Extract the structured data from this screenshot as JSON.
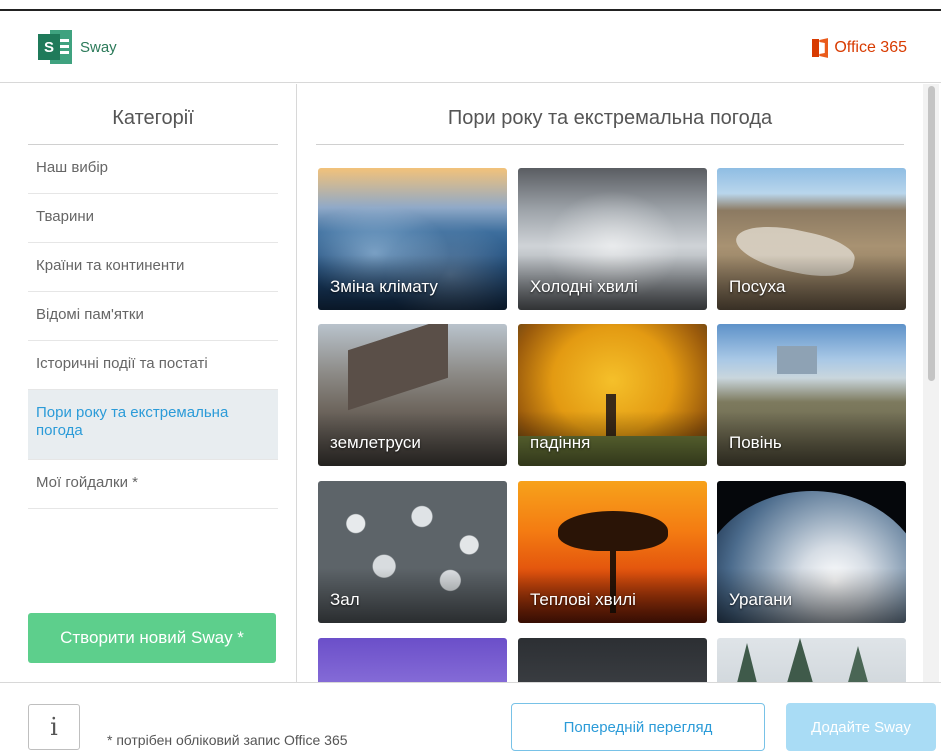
{
  "header": {
    "app_name": "Sway",
    "app_badge": "S",
    "brand": "Office 365"
  },
  "sidebar": {
    "title": "Категорії",
    "items": [
      {
        "label": "Наш вибір"
      },
      {
        "label": "Тварини"
      },
      {
        "label": "Країни та континенти"
      },
      {
        "label": "Відомі пам'ятки"
      },
      {
        "label": "Історичні події та постаті"
      },
      {
        "label": "Пори року та екстремальна погода",
        "active": true
      },
      {
        "label": "Мої гойдалки *"
      }
    ],
    "create_button": "Створити новий Sway *"
  },
  "main": {
    "title": "Пори року та екстремальна погода",
    "tiles": [
      {
        "label": "Зміна клімату",
        "image": "climate-change-image"
      },
      {
        "label": "Холодні хвилі",
        "image": "cold-waves-image"
      },
      {
        "label": "Посуха",
        "image": "drought-image"
      },
      {
        "label": "землетруси",
        "image": "earthquakes-image"
      },
      {
        "label": "падіння",
        "image": "autumn-image"
      },
      {
        "label": "Повінь",
        "image": "flood-image"
      },
      {
        "label": "Зал",
        "image": "hail-image"
      },
      {
        "label": "Теплові хвилі",
        "image": "heat-waves-image"
      },
      {
        "label": "Урагани",
        "image": "hurricanes-image"
      },
      {
        "label": "",
        "image": "lightning-image"
      },
      {
        "label": "",
        "image": "rain-image"
      },
      {
        "label": "",
        "image": "snow-image"
      }
    ]
  },
  "footer": {
    "info_glyph": "i",
    "footnote": "* потрібен обліковий запис Office 365",
    "preview_button": "Попередній перегляд",
    "add_button": "Додайте Sway"
  },
  "colors": {
    "accent_blue": "#2b9bd8",
    "create_green": "#5dcf8c",
    "office_orange": "#d83b01",
    "sway_green": "#2b7a59"
  }
}
